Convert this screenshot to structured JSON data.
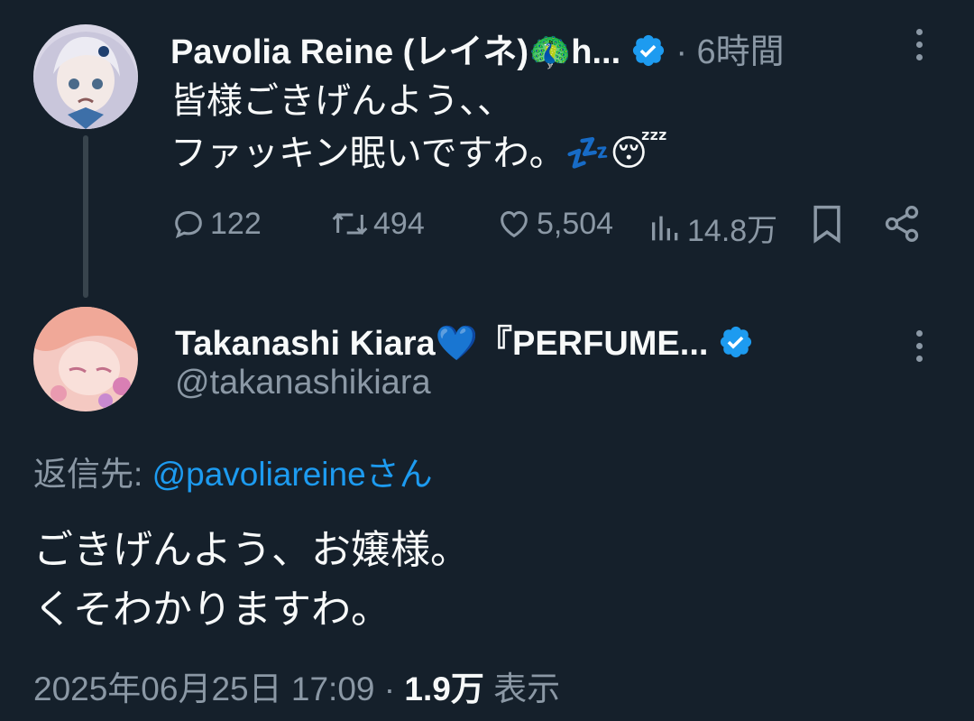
{
  "parent_tweet": {
    "author_name": "Pavolia Reine (レイネ)🦚h...",
    "time": "6時間",
    "dot": "·",
    "lines": [
      "皆様ごきげんよう、、",
      "ファッキン眠いですわ。💤😴"
    ],
    "actions": {
      "replies": "122",
      "retweets": "494",
      "likes": "5,504",
      "views": "14.8万"
    }
  },
  "reply_tweet": {
    "author_name": "Takanashi Kiara💙『PERFUME...",
    "handle": "@takanashikiara",
    "reply_to_prefix": "返信先:",
    "reply_to_handle": "@pavoliareineさん",
    "lines": [
      "ごきげんよう、お嬢様。",
      "くそわかりますわ。"
    ],
    "meta": {
      "datetime": "2025年06月25日 17:09",
      "dot": "·",
      "views": "1.9万",
      "views_label": "表示"
    }
  },
  "colors": {
    "background": "#15202b",
    "text": "#f7f9f9",
    "muted": "#8b98a5",
    "accent": "#1d9bf0",
    "thread_line": "#38444d"
  },
  "icons": [
    "verified-badge-icon",
    "more-icon",
    "reply-icon",
    "retweet-icon",
    "like-icon",
    "views-icon",
    "bookmark-icon",
    "share-icon"
  ]
}
